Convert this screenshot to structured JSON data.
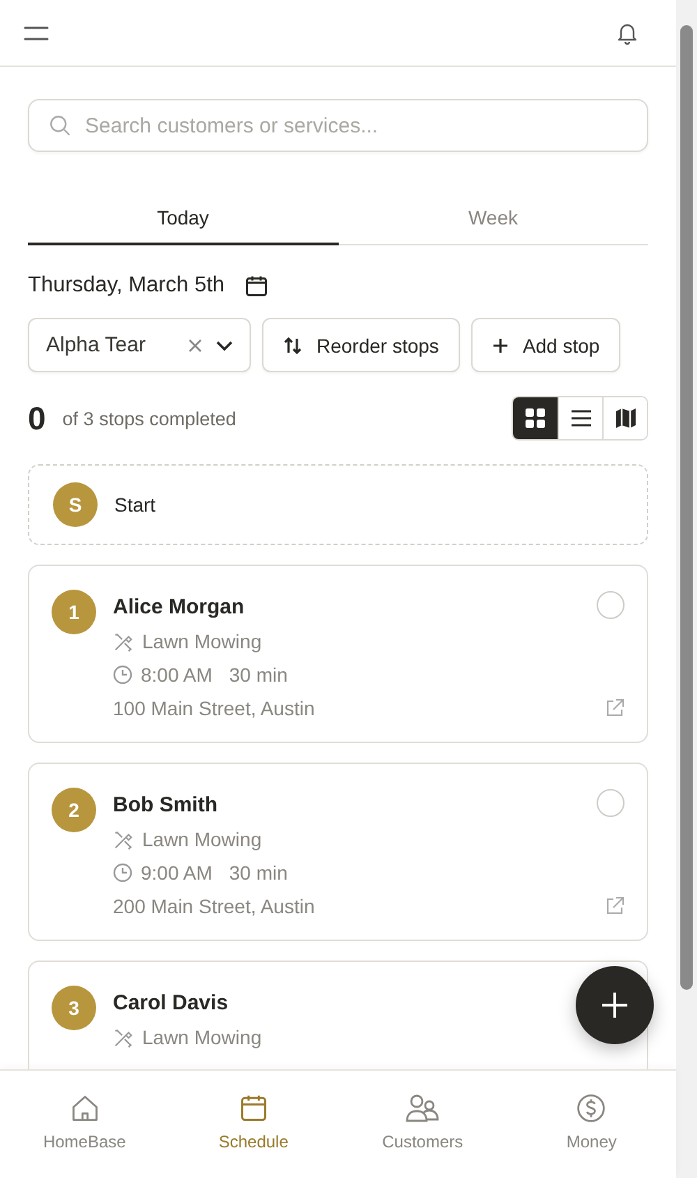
{
  "search": {
    "placeholder": "Search customers or services..."
  },
  "tabs": [
    {
      "label": "Today",
      "selected": true
    },
    {
      "label": "Week",
      "selected": false
    }
  ],
  "date": "Thursday, March 5th",
  "crew_select": {
    "value": "Alpha Tear"
  },
  "actions": [
    {
      "label": "Reorder stops",
      "kind": "reorder"
    },
    {
      "label": "Add stop",
      "kind": "add"
    }
  ],
  "progress": {
    "count": "0",
    "text": "of 3 stops completed"
  },
  "view_modes": [
    {
      "kind": "grid",
      "selected": true
    },
    {
      "kind": "list",
      "selected": false
    },
    {
      "kind": "map",
      "selected": false
    }
  ],
  "start": {
    "badge": "S",
    "label": "Start"
  },
  "stops": [
    {
      "number": "1",
      "name": "Alice Morgan",
      "service": "Lawn Mowing",
      "time": "8:00 AM",
      "duration": "30 min",
      "address": "100 Main Street, Austin",
      "completed": false
    },
    {
      "number": "2",
      "name": "Bob Smith",
      "service": "Lawn Mowing",
      "time": "9:00 AM",
      "duration": "30 min",
      "address": "200 Main Street, Austin",
      "completed": false
    },
    {
      "number": "3",
      "name": "Carol Davis",
      "service": "Lawn Mowing"
    }
  ],
  "nav": [
    {
      "label": "HomeBase",
      "kind": "home",
      "selected": false
    },
    {
      "label": "Schedule",
      "kind": "schedule",
      "selected": true
    },
    {
      "label": "Customers",
      "kind": "customers",
      "selected": false
    },
    {
      "label": "Money",
      "kind": "money",
      "selected": false
    }
  ]
}
